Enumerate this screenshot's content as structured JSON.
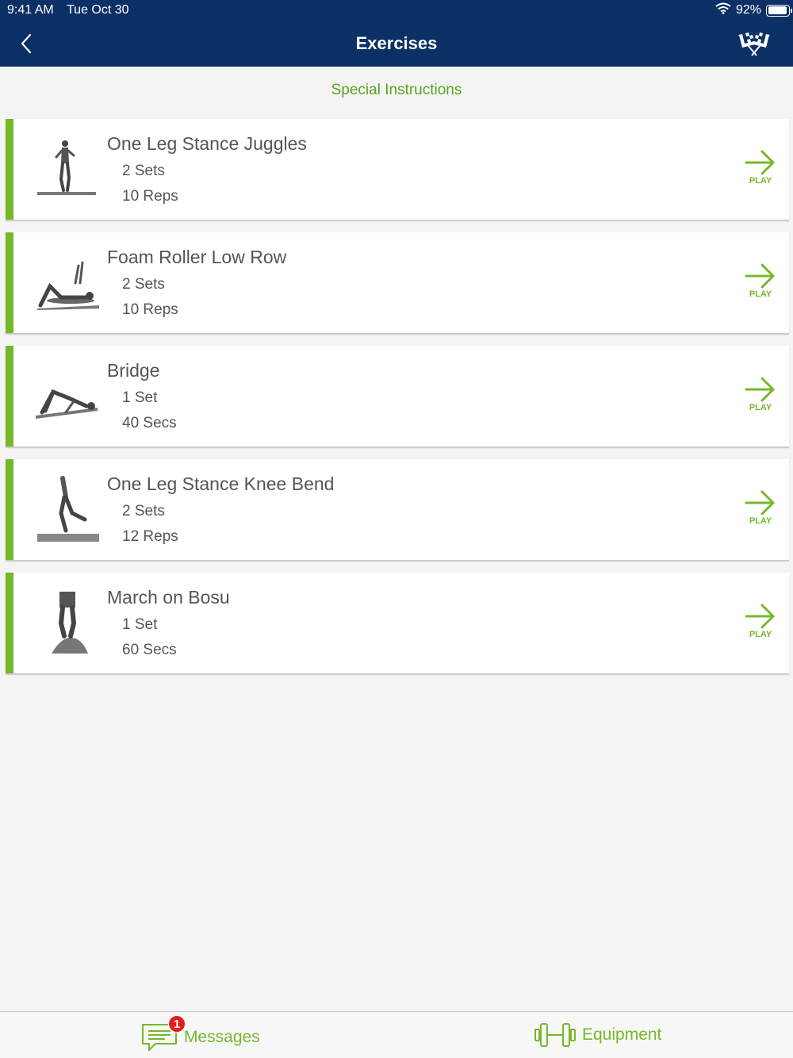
{
  "status": {
    "time": "9:41 AM",
    "date": "Tue Oct 30",
    "battery_text": "92%",
    "battery_level": 0.92
  },
  "nav": {
    "title": "Exercises",
    "back_icon": "chevron-left-icon",
    "action_icon": "checkered-flags-icon"
  },
  "special_instructions": "Special Instructions",
  "play_label": "PLAY",
  "exercises": [
    {
      "name": "One Leg Stance Juggles",
      "sets": "2 Sets",
      "reps": "10 Reps"
    },
    {
      "name": "Foam Roller Low Row",
      "sets": "2 Sets",
      "reps": "10 Reps"
    },
    {
      "name": "Bridge",
      "sets": "1 Set",
      "reps": "40 Secs"
    },
    {
      "name": "One Leg Stance Knee Bend",
      "sets": "2 Sets",
      "reps": "12 Reps"
    },
    {
      "name": "March on Bosu",
      "sets": "1 Set",
      "reps": "60 Secs"
    }
  ],
  "tabs": {
    "messages": {
      "label": "Messages",
      "badge": "1",
      "icon": "message-icon"
    },
    "equipment": {
      "label": "Equipment",
      "icon": "dumbbell-icon"
    }
  },
  "colors": {
    "header_bg": "#0b3066",
    "accent_green": "#76b82a",
    "badge_red": "#e41d1d"
  }
}
